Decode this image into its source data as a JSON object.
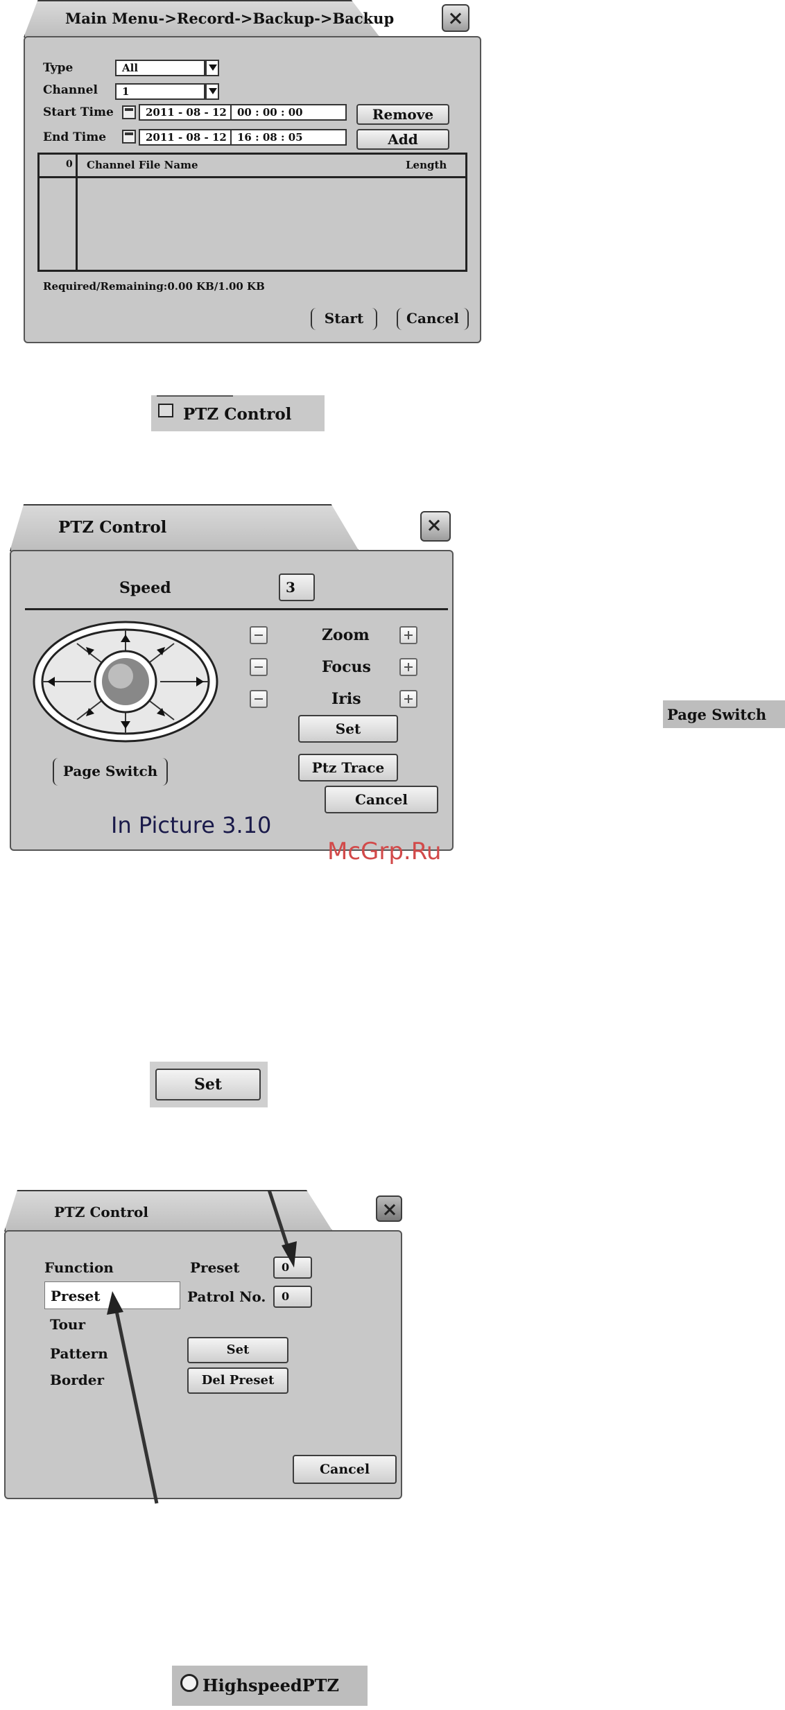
{
  "backup": {
    "title": "Main Menu->Record->Backup->Backup",
    "type_label": "Type",
    "type_value": "All",
    "channel_label": "Channel",
    "channel_value": "1",
    "start_label": "Start Time",
    "start_date": "2011 - 08 - 12",
    "start_time": "00 : 00 : 00",
    "end_label": "End Time",
    "end_date": "2011 - 08 - 12",
    "end_time": "16 : 08 : 05",
    "remove_label": "Remove",
    "add_label": "Add",
    "table": {
      "col_index": "0",
      "col_name": "Channel File Name",
      "col_length": "Length"
    },
    "required": "Required/Remaining:0.00 KB/1.00 KB",
    "start_btn": "Start",
    "cancel_btn": "Cancel"
  },
  "menu_snippet": {
    "label": "PTZ Control"
  },
  "ptz": {
    "title": "PTZ Control",
    "speed_label": "Speed",
    "speed_value": "3",
    "zoom_label": "Zoom",
    "focus_label": "Focus",
    "iris_label": "Iris",
    "set_btn": "Set",
    "trace_btn": "Ptz Trace",
    "page_switch_btn": "Page Switch",
    "cancel_btn": "Cancel",
    "caption": "In Picture 3.10"
  },
  "page_switch_snippet": {
    "label": "Page Switch"
  },
  "watermark": "McGrp.Ru",
  "set_snippet": {
    "label": "Set"
  },
  "ptz2": {
    "title": "PTZ Control",
    "function_label": "Function",
    "functions": [
      "Preset",
      "Tour",
      "Pattern",
      "Border"
    ],
    "preset_label": "Preset",
    "preset_value": "0",
    "patrol_label": "Patrol No.",
    "patrol_value": "0",
    "set_btn": "Set",
    "del_btn": "Del Preset",
    "cancel_btn": "Cancel"
  },
  "highspeed_snippet": {
    "label": "HighspeedPTZ"
  }
}
